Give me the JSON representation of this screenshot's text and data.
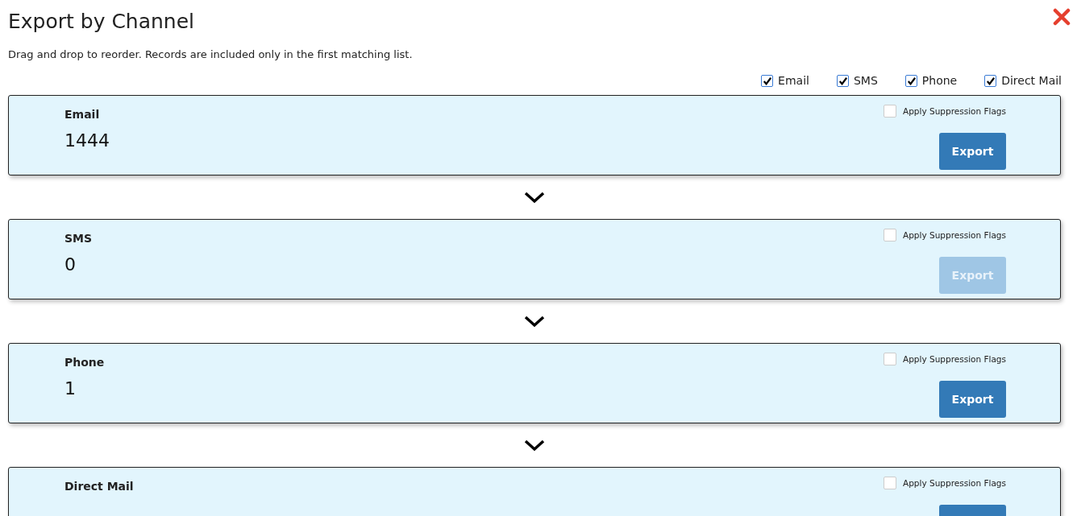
{
  "dialog": {
    "title": "Export by Channel",
    "subtitle": "Drag and drop to reorder. Records are included only in the first matching list."
  },
  "filters": [
    {
      "label": "Email",
      "checked": true
    },
    {
      "label": "SMS",
      "checked": true
    },
    {
      "label": "Phone",
      "checked": true
    },
    {
      "label": "Direct Mail",
      "checked": true
    }
  ],
  "channels": [
    {
      "name": "Email",
      "count": "1444",
      "suppression_label": "Apply Suppression Flags",
      "suppression_checked": false,
      "export_label": "Export",
      "export_disabled": false
    },
    {
      "name": "SMS",
      "count": "0",
      "suppression_label": "Apply Suppression Flags",
      "suppression_checked": false,
      "export_label": "Export",
      "export_disabled": true
    },
    {
      "name": "Phone",
      "count": "1",
      "suppression_label": "Apply Suppression Flags",
      "suppression_checked": false,
      "export_label": "Export",
      "export_disabled": false
    },
    {
      "name": "Direct Mail",
      "suppression_label": "Apply Suppression Flags",
      "suppression_checked": false,
      "export_disabled": false
    }
  ]
}
